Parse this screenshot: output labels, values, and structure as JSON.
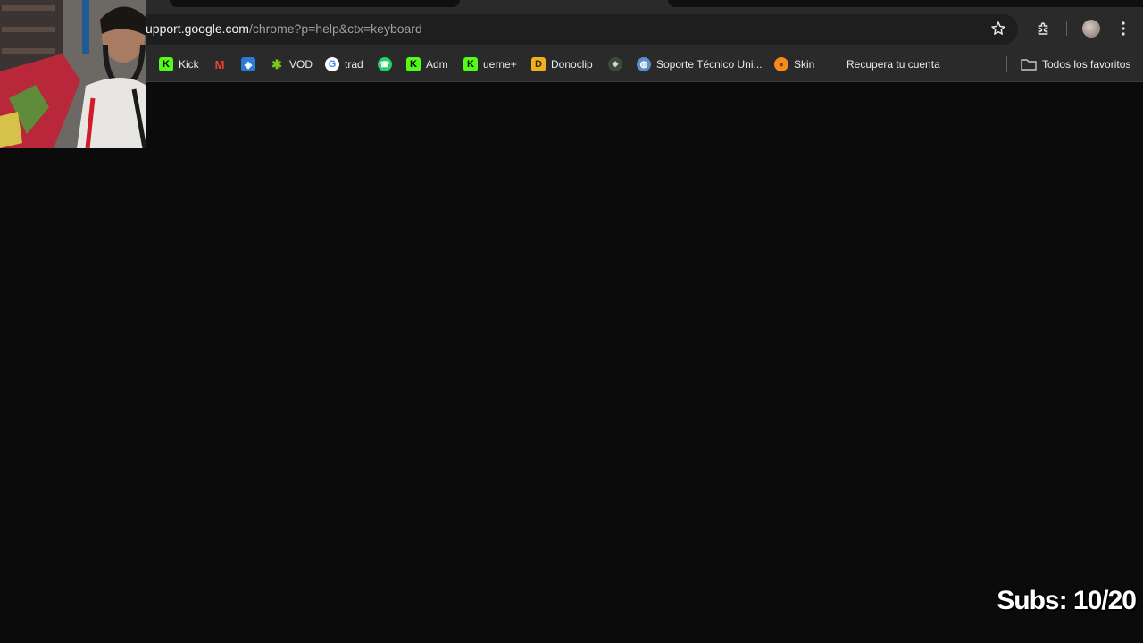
{
  "address_bar": {
    "host": "upport.google.com",
    "path": "/chrome?p=help&ctx=keyboard"
  },
  "toolbar_icons": {
    "star": "star-icon",
    "extensions": "puzzle-icon",
    "profile": "avatar",
    "menu": "kebab-menu-icon"
  },
  "bookmarks": [
    {
      "label": "Kick",
      "icon": "kick-icon"
    },
    {
      "label": "",
      "icon": "gmail-icon"
    },
    {
      "label": "",
      "icon": "blue-square-icon"
    },
    {
      "label": "VOD",
      "icon": "vod-icon"
    },
    {
      "label": "trad",
      "icon": "google-icon"
    },
    {
      "label": "",
      "icon": "whatsapp-icon"
    },
    {
      "label": "Adm",
      "icon": "kick-icon"
    },
    {
      "label": "uerne+",
      "icon": "kick-icon"
    },
    {
      "label": "Donoclip",
      "icon": "donoclip-icon"
    },
    {
      "label": "",
      "icon": "badge-icon"
    },
    {
      "label": "Soporte Técnico Uni...",
      "icon": "globe-icon"
    },
    {
      "label": "Skin",
      "icon": "pumpkin-icon"
    },
    {
      "label": "Recupera tu cuenta",
      "icon": "microsoft-icon"
    }
  ],
  "all_bookmarks": {
    "label": "Todos los favoritos",
    "icon": "folder-icon"
  },
  "overlay": {
    "subs": "Subs: 10/20"
  },
  "colors": {
    "chrome_bg": "#2a2a2a",
    "omnibox_bg": "#1e1e1e",
    "page_bg": "#0b0b0b",
    "kick_green": "#53fc18"
  }
}
